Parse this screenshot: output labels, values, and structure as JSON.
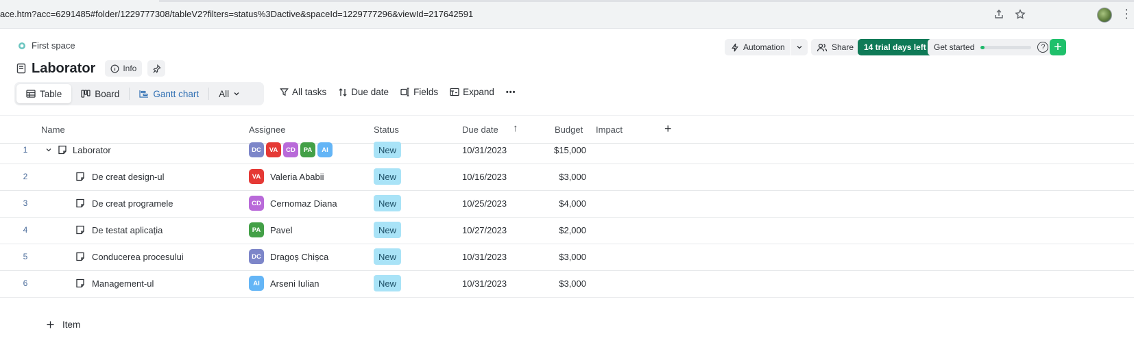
{
  "browser": {
    "url": "ace.htm?acc=6291485#folder/1229777308/tableV2?filters=status%3Dactive&spaceId=1229777296&viewId=217642591"
  },
  "header": {
    "space_name": "First space",
    "title": "Laborator",
    "info_label": "Info",
    "automation_label": "Automation",
    "share_label": "Share",
    "trial_label": "14 trial days left",
    "get_started_label": "Get started",
    "get_started_progress": 0.08,
    "help_glyph": "?",
    "add_glyph": "+"
  },
  "toolbar": {
    "tabs": [
      {
        "label": "Table",
        "icon": "table-icon",
        "active": true
      },
      {
        "label": "Board",
        "icon": "board-icon",
        "active": false
      },
      {
        "label": "Gantt chart",
        "icon": "gantt-icon",
        "active": false
      },
      {
        "label": "All",
        "icon": "chevron-down-icon",
        "active": false
      }
    ],
    "filter_label": "All tasks",
    "sort_label": "Due date",
    "fields_label": "Fields",
    "expand_label": "Expand",
    "more_glyph": "•••"
  },
  "table": {
    "columns": [
      "Name",
      "Assignee",
      "Status",
      "Due date",
      "Budget",
      "Impact"
    ],
    "sort_glyph": "↑",
    "add_column_glyph": "+",
    "rows": [
      {
        "num": "1",
        "name": "Laborator",
        "is_group": true,
        "assignees": [
          "DC",
          "VA",
          "CD",
          "PA",
          "AI"
        ],
        "assignee_name": "",
        "status": "New",
        "due": "10/31/2023",
        "budget": "$15,000"
      },
      {
        "num": "2",
        "name": "De creat design-ul",
        "is_group": false,
        "assignees": [
          "VA"
        ],
        "assignee_name": "Valeria Ababii",
        "status": "New",
        "due": "10/16/2023",
        "budget": "$3,000"
      },
      {
        "num": "3",
        "name": "De creat programele",
        "is_group": false,
        "assignees": [
          "CD"
        ],
        "assignee_name": "Cernomaz Diana",
        "status": "New",
        "due": "10/25/2023",
        "budget": "$4,000"
      },
      {
        "num": "4",
        "name": "De testat aplicația",
        "is_group": false,
        "assignees": [
          "PA"
        ],
        "assignee_name": "Pavel",
        "status": "New",
        "due": "10/27/2023",
        "budget": "$2,000"
      },
      {
        "num": "5",
        "name": "Conducerea procesului",
        "is_group": false,
        "assignees": [
          "DC"
        ],
        "assignee_name": "Dragoș Chișca",
        "status": "New",
        "due": "10/31/2023",
        "budget": "$3,000"
      },
      {
        "num": "6",
        "name": "Management-ul",
        "is_group": false,
        "assignees": [
          "AI"
        ],
        "assignee_name": "Arseni Iulian",
        "status": "New",
        "due": "10/31/2023",
        "budget": "$3,000"
      }
    ],
    "add_item_label": "Item"
  },
  "colors": {
    "DC": "#7d86c9",
    "VA": "#e53935",
    "CD": "#b96ad9",
    "PA": "#43a047",
    "AI": "#64b5f6",
    "status_new": "#a9e3f7",
    "trial": "#0f7a57",
    "add_button": "#1fc06b"
  }
}
